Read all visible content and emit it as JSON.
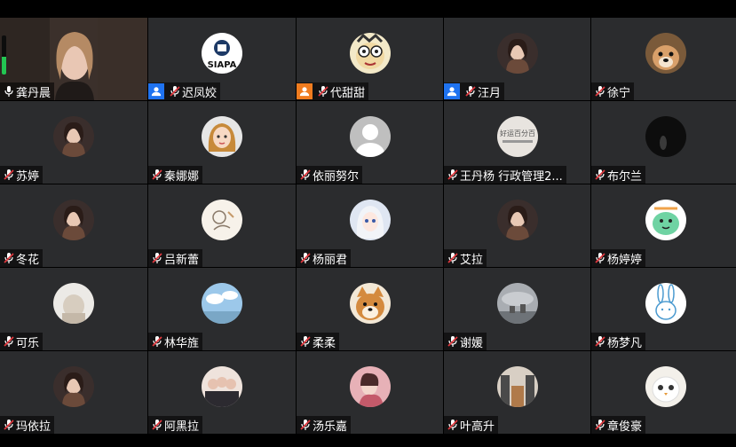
{
  "meeting": {
    "audio_level": 0.45,
    "participants": [
      {
        "name": "龚丹晨",
        "mic": "on",
        "video": true,
        "speaking": true
      },
      {
        "name": "迟凤姣",
        "mic": "muted",
        "host_badge": "blue",
        "avatar": "siapa-logo",
        "avatar_text": "SIAPA"
      },
      {
        "name": "代甜甜",
        "mic": "muted",
        "host_badge": "orange",
        "avatar": "cartoon-face"
      },
      {
        "name": "汪月",
        "mic": "muted",
        "host_badge": "blue",
        "avatar": "photo"
      },
      {
        "name": "徐宁",
        "mic": "muted",
        "avatar": "dog-photo"
      },
      {
        "name": "苏婷",
        "mic": "muted",
        "avatar": "photo"
      },
      {
        "name": "秦娜娜",
        "mic": "muted",
        "avatar": "cartoon-girl"
      },
      {
        "name": "依丽努尔",
        "mic": "muted",
        "avatar": "default"
      },
      {
        "name": "王丹杨 行政管理2...",
        "mic": "muted",
        "avatar": "text-avatar",
        "avatar_text": "好运百分百"
      },
      {
        "name": "布尔兰",
        "mic": "muted",
        "avatar": "dark-photo"
      },
      {
        "name": "冬花",
        "mic": "muted",
        "avatar": "photo"
      },
      {
        "name": "吕新蕾",
        "mic": "muted",
        "avatar": "drawing"
      },
      {
        "name": "杨丽君",
        "mic": "muted",
        "avatar": "anime"
      },
      {
        "name": "艾拉",
        "mic": "muted",
        "avatar": "photo"
      },
      {
        "name": "杨婷婷",
        "mic": "muted",
        "avatar": "green-creature"
      },
      {
        "name": "可乐",
        "mic": "muted",
        "avatar": "light-photo"
      },
      {
        "name": "林华旌",
        "mic": "muted",
        "avatar": "sky"
      },
      {
        "name": "柔柔",
        "mic": "muted",
        "avatar": "shiba"
      },
      {
        "name": "谢媛",
        "mic": "muted",
        "avatar": "cloudy"
      },
      {
        "name": "杨梦凡",
        "mic": "muted",
        "avatar": "bunny"
      },
      {
        "name": "玛依拉",
        "mic": "muted",
        "avatar": "photo"
      },
      {
        "name": "阿黑拉",
        "mic": "muted",
        "avatar": "group-photo"
      },
      {
        "name": "汤乐嘉",
        "mic": "muted",
        "avatar": "pink-photo"
      },
      {
        "name": "叶高升",
        "mic": "muted",
        "avatar": "city"
      },
      {
        "name": "章俊豪",
        "mic": "muted",
        "avatar": "white-bird"
      }
    ]
  },
  "colors": {
    "tile_bg": "#2b2c2e",
    "active_border": "#23c552",
    "host_blue": "#1f73f0",
    "host_orange": "#f07c1f",
    "mic_muted": "#e0383e"
  },
  "icons": {
    "mic_on": "microphone-icon",
    "mic_muted": "microphone-muted-icon",
    "host": "user-icon"
  }
}
